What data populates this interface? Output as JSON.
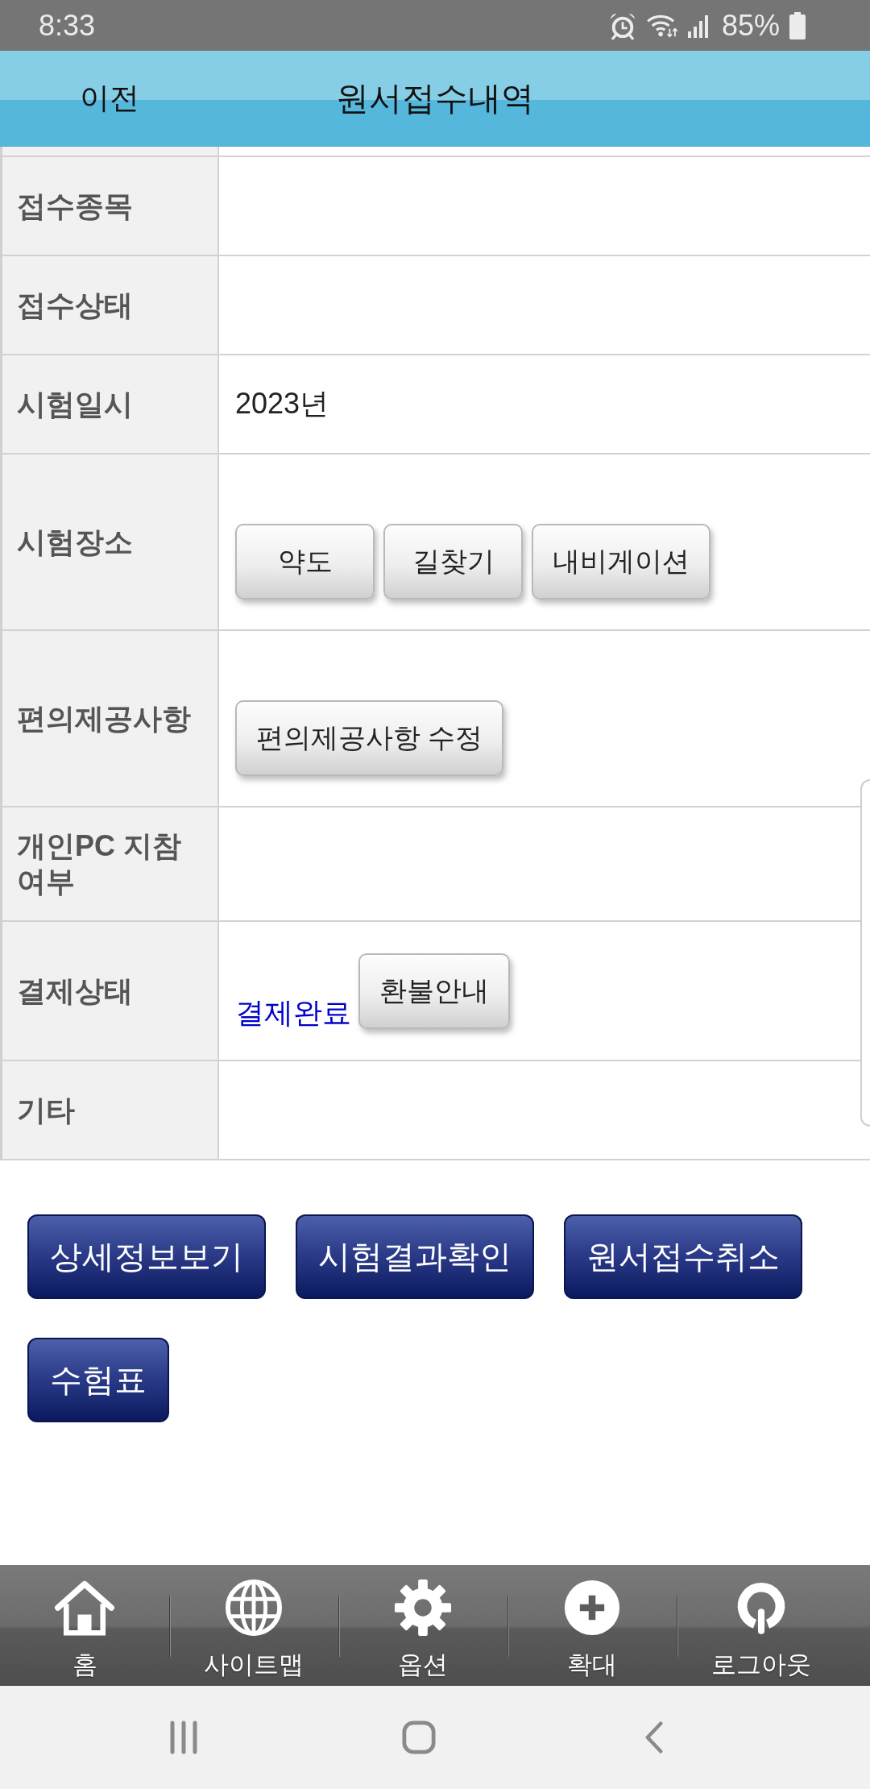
{
  "status_bar": {
    "time": "8:33",
    "battery": "85%"
  },
  "header": {
    "back": "이전",
    "title": "원서접수내역"
  },
  "table": {
    "rows": [
      {
        "kind": "text",
        "label": "접수종목"
      },
      {
        "kind": "text",
        "label": "접수상태"
      },
      {
        "kind": "text",
        "label": "시험일시",
        "value": "2023년"
      },
      {
        "kind": "buttons",
        "label": "시험장소",
        "buttons": [
          "약도",
          "길찾기",
          "내비게이션"
        ]
      },
      {
        "kind": "buttons",
        "label": "편의제공사항",
        "buttons": [
          "편의제공사항 수정"
        ]
      },
      {
        "kind": "text",
        "label": "개인PC 지참 여부"
      },
      {
        "kind": "status",
        "label": "결제상태",
        "value": "결제완료",
        "buttons": [
          "환불안내"
        ]
      },
      {
        "kind": "text",
        "label": "기타"
      }
    ]
  },
  "actions": [
    "상세정보보기",
    "시험결과확인",
    "원서접수취소",
    "수험표"
  ],
  "bottom_nav": [
    {
      "label": "홈"
    },
    {
      "label": "사이트맵"
    },
    {
      "label": "옵션"
    },
    {
      "label": "확대"
    },
    {
      "label": "로그아웃"
    }
  ]
}
